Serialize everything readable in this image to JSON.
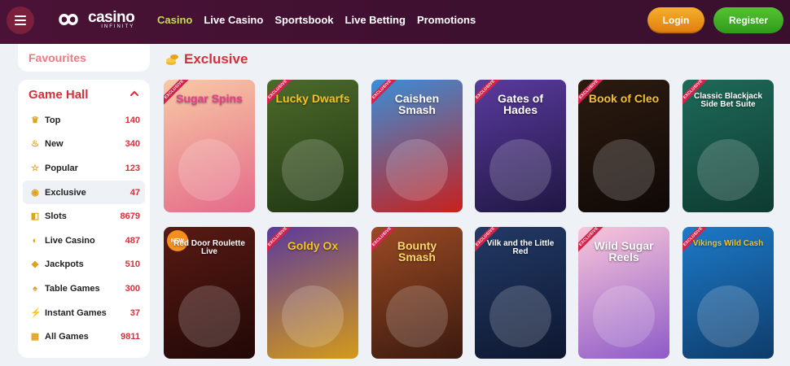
{
  "header": {
    "logo_word": "casino",
    "logo_sub": "INFINITY",
    "nav": [
      {
        "label": "Casino",
        "active": true
      },
      {
        "label": "Live Casino",
        "active": false
      },
      {
        "label": "Sportsbook",
        "active": false
      },
      {
        "label": "Live Betting",
        "active": false
      },
      {
        "label": "Promotions",
        "active": false
      }
    ],
    "login_label": "Login",
    "register_label": "Register"
  },
  "sidebar": {
    "favourites_label": "Favourites",
    "game_hall_title": "Game Hall",
    "categories": [
      {
        "label": "Top",
        "count": "140",
        "icon": "crown-icon"
      },
      {
        "label": "New",
        "count": "340",
        "icon": "flame-icon"
      },
      {
        "label": "Popular",
        "count": "123",
        "icon": "star-icon"
      },
      {
        "label": "Exclusive",
        "count": "47",
        "icon": "coins-icon",
        "active": true
      },
      {
        "label": "Slots",
        "count": "8679",
        "icon": "slots-icon"
      },
      {
        "label": "Live Casino",
        "count": "487",
        "icon": "live-icon"
      },
      {
        "label": "Jackpots",
        "count": "510",
        "icon": "jackpot-icon"
      },
      {
        "label": "Table Games",
        "count": "300",
        "icon": "table-icon"
      },
      {
        "label": "Instant Games",
        "count": "37",
        "icon": "instant-icon"
      },
      {
        "label": "All Games",
        "count": "9811",
        "icon": "all-games-icon"
      }
    ]
  },
  "main": {
    "section_title": "Exclusive",
    "badge_text": "EXCLUSIVE",
    "new_badge_text": "NEW",
    "games": [
      {
        "title": "Sugar Spins",
        "color1": "#f8c9a4",
        "color2": "#e46a8a",
        "text_color": "#e83e8c"
      },
      {
        "title": "Lucky Dwarfs",
        "color1": "#4d6b2a",
        "color2": "#1f3513",
        "text_color": "#f5c325"
      },
      {
        "title": "Caishen Smash",
        "color1": "#3a8ed8",
        "color2": "#c7211f",
        "text_color": "#ffffff"
      },
      {
        "title": "Gates of Hades",
        "color1": "#5a3b9e",
        "color2": "#1f1642",
        "text_color": "#ffffff"
      },
      {
        "title": "Book of Cleo",
        "color1": "#2c1b10",
        "color2": "#0f0907",
        "text_color": "#f2c234"
      },
      {
        "title": "Classic Blackjack Side Bet Suite",
        "color1": "#1d6a59",
        "color2": "#0e3a31",
        "text_color": "#ffffff"
      },
      {
        "title": "Red Door Roulette Live",
        "color1": "#5a1a14",
        "color2": "#200806",
        "text_color": "#ffffff"
      },
      {
        "title": "Goldy Ox",
        "color1": "#5c3a9c",
        "color2": "#d39a19",
        "text_color": "#f5c325"
      },
      {
        "title": "Bounty Smash",
        "color1": "#9a4a24",
        "color2": "#3b1a0f",
        "text_color": "#ffd66b"
      },
      {
        "title": "Vilk and the Little Red",
        "color1": "#233a66",
        "color2": "#0d1730",
        "text_color": "#ffffff"
      },
      {
        "title": "Wild Sugar Reels",
        "color1": "#f9c6d9",
        "color2": "#8e5bc9",
        "text_color": "#ffffff"
      },
      {
        "title": "Vikings Wild Cash",
        "color1": "#1d7ac8",
        "color2": "#0e3c6b",
        "text_color": "#f5c325"
      }
    ]
  }
}
